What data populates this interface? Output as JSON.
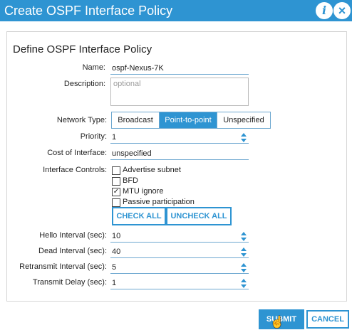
{
  "dialog": {
    "title": "Create OSPF Interface Policy",
    "info_icon": "i",
    "close_icon": "×"
  },
  "form": {
    "heading": "Define OSPF Interface Policy",
    "name": {
      "label": "Name:",
      "value": "ospf-Nexus-7K"
    },
    "description": {
      "label": "Description:",
      "placeholder": "optional"
    },
    "network_type": {
      "label": "Network Type:",
      "options": [
        "Broadcast",
        "Point-to-point",
        "Unspecified"
      ],
      "selected": "Point-to-point"
    },
    "priority": {
      "label": "Priority:",
      "value": "1"
    },
    "cost": {
      "label": "Cost of Interface:",
      "value": "unspecified"
    },
    "interface_controls": {
      "label": "Interface Controls:",
      "items": [
        {
          "label": "Advertise subnet",
          "checked": false
        },
        {
          "label": "BFD",
          "checked": false
        },
        {
          "label": "MTU ignore",
          "checked": true
        },
        {
          "label": "Passive participation",
          "checked": false
        }
      ],
      "check_all": "CHECK ALL",
      "uncheck_all": "UNCHECK ALL"
    },
    "hello": {
      "label": "Hello Interval (sec):",
      "value": "10"
    },
    "dead": {
      "label": "Dead Interval (sec):",
      "value": "40"
    },
    "retransmit": {
      "label": "Retransmit Interval (sec):",
      "value": "5"
    },
    "transmit_delay": {
      "label": "Transmit Delay (sec):",
      "value": "1"
    }
  },
  "footer": {
    "submit": "SUBMIT",
    "cancel": "CANCEL"
  },
  "colors": {
    "accent": "#2e94d2"
  },
  "icons": {
    "info": "info-icon",
    "close": "close-icon",
    "spinner": "spinner-arrows-icon",
    "checkmark": "checkmark-icon",
    "cursor": "hand-pointer-icon"
  }
}
